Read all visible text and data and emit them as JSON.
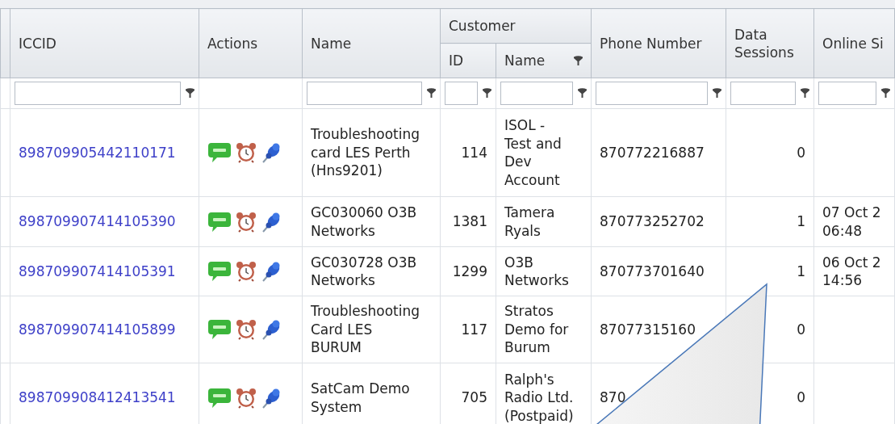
{
  "table": {
    "columns": [
      {
        "label": "ICCID",
        "filter": true
      },
      {
        "label": "Actions",
        "filter": false
      },
      {
        "label": "Name",
        "filter": true
      },
      {
        "label": "Customer",
        "children": [
          {
            "label": "ID",
            "filter": true,
            "header_filter": false
          },
          {
            "label": "Name",
            "filter": true,
            "header_filter": true
          }
        ]
      },
      {
        "label": "Phone Number",
        "filter": true
      },
      {
        "label": "Data Sessions",
        "filter": true
      },
      {
        "label": "Online Si",
        "filter": true
      }
    ],
    "rows": [
      {
        "iccid": "898709905442110171",
        "actions": [
          {
            "kind": "sms"
          },
          {
            "kind": "alarm"
          },
          {
            "kind": "pin"
          }
        ],
        "name": [
          "Troubleshooting",
          "card LES Perth",
          "(Hns9201)"
        ],
        "customer_id": "114",
        "customer_name": [
          "ISOL -",
          "Test and",
          "Dev",
          "Account"
        ],
        "phone": "870772216887",
        "data_sessions": "0",
        "online_since": []
      },
      {
        "iccid": "898709907414105390",
        "actions": [
          {
            "kind": "sms"
          },
          {
            "kind": "alarm"
          },
          {
            "kind": "pin"
          }
        ],
        "name": [
          "GC030060 O3B",
          "Networks"
        ],
        "customer_id": "1381",
        "customer_name": [
          "Tamera",
          "Ryals"
        ],
        "phone": "870773252702",
        "data_sessions": "1",
        "online_since": [
          "07 Oct 2",
          "06:48"
        ]
      },
      {
        "iccid": "898709907414105391",
        "actions": [
          {
            "kind": "sms"
          },
          {
            "kind": "alarm"
          },
          {
            "kind": "pin"
          }
        ],
        "name": [
          "GC030728 O3B",
          "Networks"
        ],
        "customer_id": "1299",
        "customer_name": [
          "O3B",
          "Networks"
        ],
        "phone": "870773701640",
        "data_sessions": "1",
        "online_since": [
          "06 Oct 2",
          "14:56"
        ]
      },
      {
        "iccid": "898709907414105899",
        "actions": [
          {
            "kind": "sms"
          },
          {
            "kind": "alarm"
          },
          {
            "kind": "pin"
          }
        ],
        "name": [
          "Troubleshooting",
          "Card LES",
          "BURUM"
        ],
        "customer_id": "117",
        "customer_name": [
          "Stratos",
          "Demo for",
          "Burum"
        ],
        "phone": "87077315160",
        "data_sessions": "0",
        "online_since": []
      },
      {
        "iccid": "898709908412413541",
        "actions": [
          {
            "kind": "sms"
          },
          {
            "kind": "alarm"
          },
          {
            "kind": "pin"
          }
        ],
        "name": [
          "SatCam Demo",
          "System"
        ],
        "customer_id": "705",
        "customer_name": [
          "Ralph's",
          "Radio Ltd.",
          "(Postpaid)"
        ],
        "phone": "870",
        "data_sessions": "0",
        "online_since": []
      }
    ]
  },
  "callout": {
    "kind": "pointer"
  }
}
